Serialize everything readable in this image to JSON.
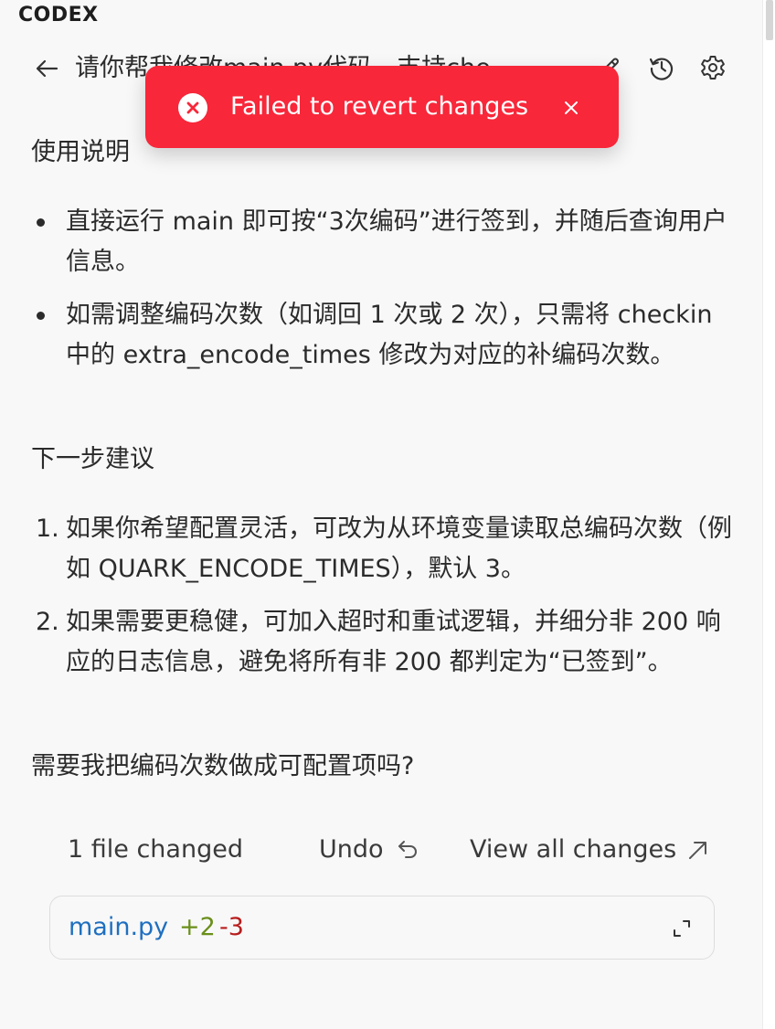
{
  "app": {
    "title": "CODEX"
  },
  "header": {
    "title": "请你帮我修改main.py代码，支持che…",
    "icons": [
      "back-arrow-icon",
      "edit-icon",
      "history-icon",
      "gear-icon"
    ]
  },
  "toast": {
    "message": "Failed to revert changes",
    "status_color": "#f8273a",
    "icon": "error-circle-icon",
    "close_icon": "close-icon"
  },
  "content": {
    "usage_heading": "使用说明",
    "usage_items": [
      "直接运行 main 即可按“3次编码”进行签到，并随后查询用户信息。",
      "如需调整编码次数（如调回 1 次或 2 次），只需将 checkin 中的 extra_encode_times 修改为对应的补编码次数。"
    ],
    "next_heading": "下一步建议",
    "next_items": [
      {
        "num": "1.",
        "text": "如果你希望配置灵活，可改为从环境变量读取总编码次数（例如 QUARK_ENCODE_TIMES），默认 3。"
      },
      {
        "num": "2.",
        "text": "如果需要更稳健，可加入超时和重试逻辑，并细分非 200 响应的日志信息，避免将所有非 200 都判定为“已签到”。"
      }
    ],
    "question": "需要我把编码次数做成可配置项吗?"
  },
  "changes": {
    "summary": "1 file changed",
    "undo_label": "Undo",
    "view_all_label": "View all changes",
    "file": {
      "name": "main.py",
      "added": "+2",
      "removed": "-3",
      "name_color": "#1f6fbf",
      "added_color": "#6a8f1a",
      "removed_color": "#b81d1d"
    }
  }
}
